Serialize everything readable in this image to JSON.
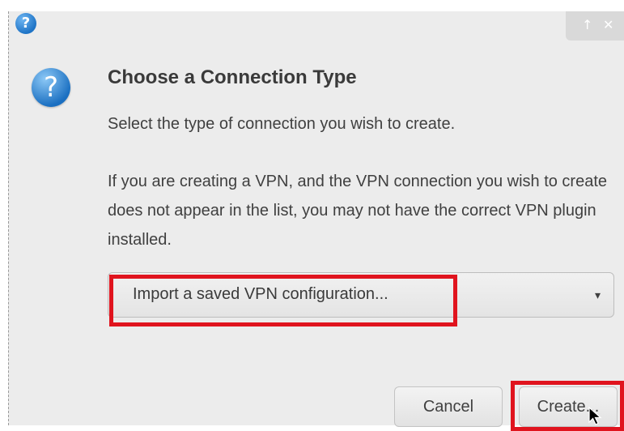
{
  "window": {
    "title_icon": "question-icon",
    "controls": {
      "up_label": "↑",
      "close_label": "✕"
    }
  },
  "dialog": {
    "icon": "question-icon",
    "title": "Choose a Connection Type",
    "subtitle": "Select the type of connection you wish to create.",
    "explain": "If you are creating a VPN, and the VPN connection you wish to create does not appear in the list, you may not have the correct VPN plugin installed.",
    "connection_select": {
      "value": "Import a saved VPN configuration...",
      "arrow": "▾"
    },
    "buttons": {
      "cancel": "Cancel",
      "create": "Create..."
    }
  },
  "annotations": {
    "highlight_color": "#e0141e"
  }
}
